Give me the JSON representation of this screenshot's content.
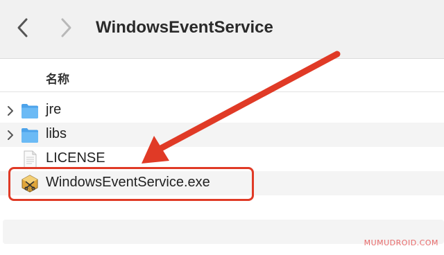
{
  "window": {
    "title": "WindowsEventService"
  },
  "toolbar": {
    "back_icon": "chevron-left-icon",
    "forward_icon": "chevron-right-icon"
  },
  "columns": {
    "name_header": "名称"
  },
  "files": [
    {
      "name": "jre",
      "kind": "folder",
      "icon": "folder-icon",
      "expandable": true
    },
    {
      "name": "libs",
      "kind": "folder",
      "icon": "folder-icon",
      "expandable": true
    },
    {
      "name": "LICENSE",
      "kind": "text-file",
      "icon": "document-icon",
      "expandable": false
    },
    {
      "name": "WindowsEventService.exe",
      "kind": "executable",
      "icon": "exe-icon",
      "expandable": false,
      "highlighted": true
    }
  ],
  "annotation": {
    "color": "#e03a26",
    "arrow_icon": "red-arrow-pointer",
    "points_to": "WindowsEventService.exe"
  },
  "colors": {
    "folder": "#5aaef0",
    "accent": "#e03a26"
  },
  "watermark": "MUMUDROID.COM"
}
